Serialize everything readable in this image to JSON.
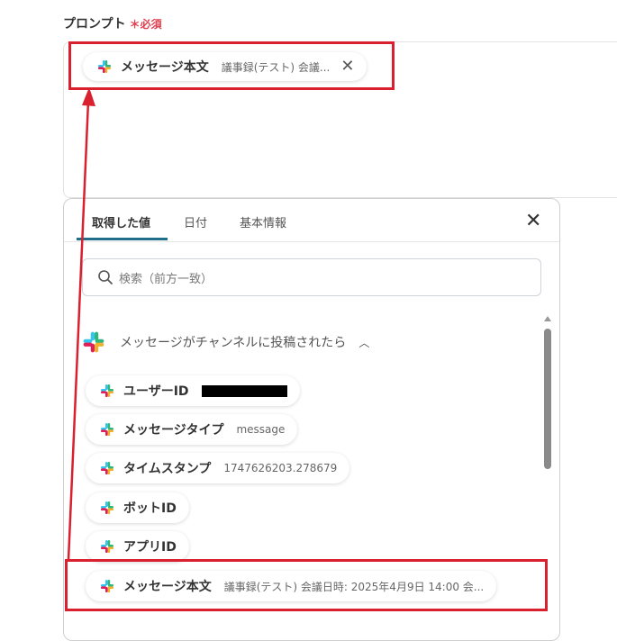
{
  "field": {
    "label": "プロンプト",
    "required_mark": "＊",
    "required_text": "必須"
  },
  "prompt_chip": {
    "key": "メッセージ本文",
    "value": "議事録(テスト) 会議..."
  },
  "panel": {
    "tabs": [
      {
        "label": "取得した値"
      },
      {
        "label": "日付"
      },
      {
        "label": "基本情報"
      }
    ],
    "search_placeholder": "検索（前方一致）",
    "section_title": "メッセージがチャンネルに投稿されたら",
    "items": [
      {
        "key": "ユーザーID",
        "value": ""
      },
      {
        "key": "メッセージタイプ",
        "value": "message"
      },
      {
        "key": "タイムスタンプ",
        "value": "1747626203.278679"
      },
      {
        "key": "ボットID",
        "value": ""
      },
      {
        "key": "アプリID",
        "value": ""
      },
      {
        "key": "メッセージ本文",
        "value": "議事録(テスト) 会議日時: 2025年4月9日 14:00 会..."
      }
    ]
  },
  "colors": {
    "highlight": "#d8202e",
    "tab_accent": "#1f6f8b",
    "required": "#e0404f"
  }
}
